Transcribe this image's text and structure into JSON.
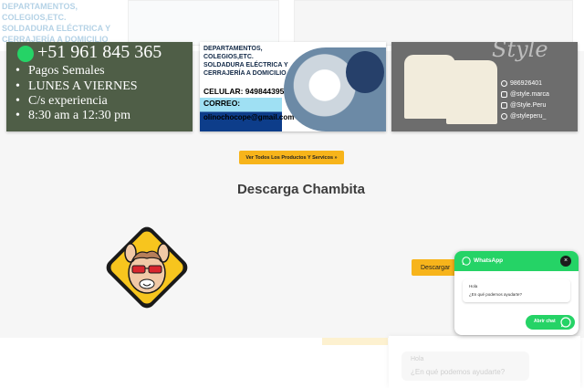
{
  "background_ghost": {
    "lines": [
      "DEPARTAMENTOS,",
      "COLEGIOS,ETC.",
      "SOLDADURA ELÉCTRICA Y",
      "CERRAJERÍA A DOMICILIO"
    ]
  },
  "gallery": {
    "card1": {
      "phone": "+51 961 845 365",
      "items": [
        "Pagos Semales",
        "LUNES A VIERNES",
        "C/s experiencia",
        "8:30 am a 12:30 pm"
      ]
    },
    "card2": {
      "lines": [
        "DEPARTAMENTOS,",
        "COLEGIOS,ETC.",
        "SOLDADURA ELÉCTRICA Y",
        "CERRAJERÍA A DOMICILIO"
      ],
      "celular": "CELULAR: 949844395",
      "correo": "CORREO:",
      "email": "olinochocope@gmail.com"
    },
    "card3": {
      "script": "Style",
      "socials": [
        "986926401",
        "@style.marca",
        "@Style.Peru",
        "@styleperu_"
      ]
    }
  },
  "cta": {
    "label": "Ver Todos Los Productos Y Servicos »"
  },
  "section": {
    "title": "Descarga Chambita"
  },
  "download": {
    "label": "Descargar"
  },
  "bottom_ghost": {
    "hola": "Hola",
    "question": "¿En qué podemos ayudarte?"
  },
  "whatsapp": {
    "title": "WhatsApp",
    "close": "×",
    "greeting": "Hola",
    "message": "¿En qué podemos ayudarte?",
    "open_label": "Abrir chat"
  },
  "colors": {
    "accent": "#f7b41b",
    "whatsapp_green": "#25d366",
    "logo_yellow": "#f7c51e"
  },
  "icons": [
    "whatsapp-icon",
    "close-icon",
    "chat-icon",
    "llama-logo"
  ]
}
